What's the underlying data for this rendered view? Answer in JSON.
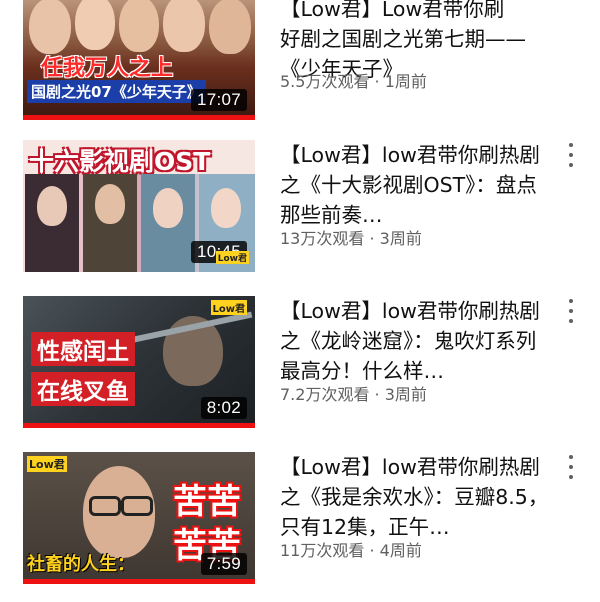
{
  "videos": [
    {
      "title": "【Low君】Low君带你刷好剧之国剧之光第七期——《少年天子》",
      "title_visible": "好剧之国剧之光第七期——\n《少年天子》",
      "views": "5.5万次观看",
      "age": "1周前",
      "duration": "17:07",
      "thumb_texts": [
        "任我万人之上",
        "国剧之光07《少年天子》"
      ]
    },
    {
      "title": "【Low君】low君带你刷热剧之《十大影视剧OST》：盘点那些前奏…",
      "views": "13万次观看",
      "age": "3周前",
      "duration": "10:45",
      "thumb_texts": [
        "十六影视剧OST"
      ]
    },
    {
      "title": "【Low君】low君带你刷热剧之《龙岭迷窟》：鬼吹灯系列最高分！什么样…",
      "views": "7.2万次观看",
      "age": "3周前",
      "duration": "8:02",
      "thumb_texts": [
        "性感闰土",
        "在线叉鱼"
      ]
    },
    {
      "title": "【Low君】low君带你刷热剧之《我是余欢水》：豆瓣8.5，只有12集，正午…",
      "views": "11万次观看",
      "age": "4周前",
      "duration": "7:59",
      "thumb_texts": [
        "苦苦",
        "苦苦",
        "社畜的人生："
      ]
    }
  ],
  "separator": " · ",
  "partial_top_title": "【Low君】Low君带你刷",
  "channel_logo_text": "Low君",
  "colors": {
    "progress": "#e11111",
    "meta": "#606060",
    "title": "#111111"
  }
}
